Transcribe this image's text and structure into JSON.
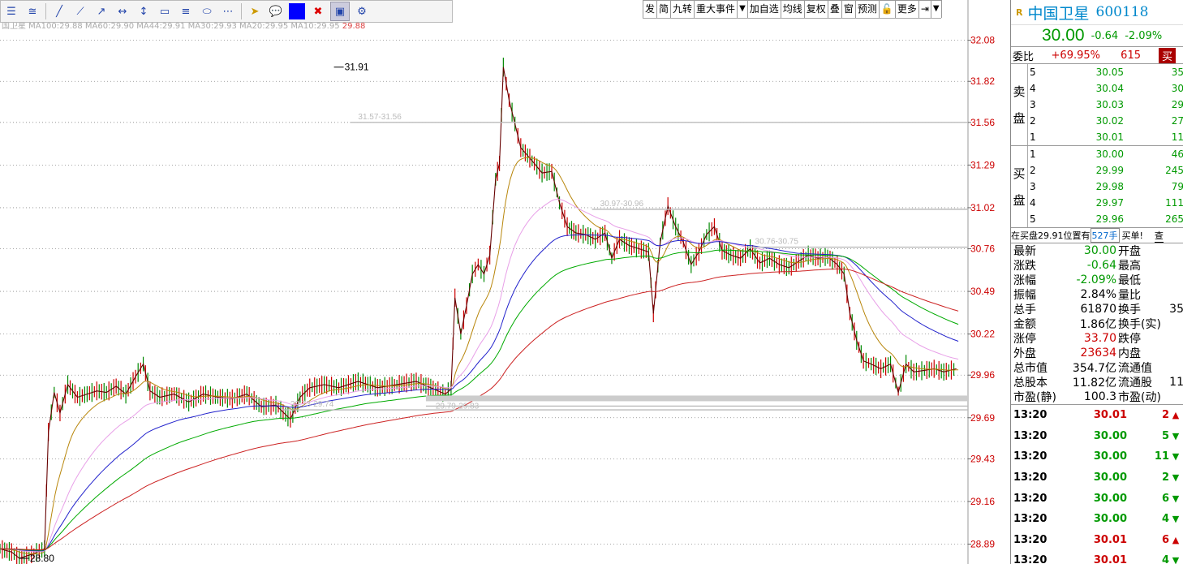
{
  "toolbar": {
    "tools": [
      "menu-icon",
      "ruler-icon",
      "line-icon",
      "segment-icon",
      "ray-icon",
      "hline-icon",
      "vline-icon",
      "rect-icon",
      "channel-icon",
      "ellipse-icon",
      "more-icon",
      "pointer-icon",
      "callout-icon",
      "color-swatch",
      "delete-icon",
      "hide-icon",
      "settings-icon"
    ]
  },
  "top_menu": [
    "发",
    "简",
    "九转",
    "重大事件",
    "",
    "加自选",
    "均线",
    "复权",
    "叠",
    "窗",
    "预测",
    "",
    "更多",
    ""
  ],
  "ma_legend": {
    "text": "国卫星  MA100:29.88  MA60:29.90  MA44:29.91  MA30:29.93  MA20:29.95  MA10:29.95",
    "highlight": "29.88"
  },
  "stock": {
    "badge": "R",
    "name": "中国卫星",
    "code": "600118",
    "price": "30.00",
    "change": "-0.64",
    "change_pct": "-2.09%",
    "ratio_label": "委比",
    "ratio_value": "+69.95%",
    "ratio_diff": "615",
    "ratio_btn": "买"
  },
  "orderbook": {
    "sell_label": [
      "卖",
      "盘"
    ],
    "buy_label": [
      "买",
      "盘"
    ],
    "sell": [
      {
        "level": "5",
        "price": "30.05",
        "vol": "35"
      },
      {
        "level": "4",
        "price": "30.04",
        "vol": "30"
      },
      {
        "level": "3",
        "price": "30.03",
        "vol": "29"
      },
      {
        "level": "2",
        "price": "30.02",
        "vol": "27"
      },
      {
        "level": "1",
        "price": "30.01",
        "vol": "11"
      }
    ],
    "buy": [
      {
        "level": "1",
        "price": "30.00",
        "vol": "46"
      },
      {
        "level": "2",
        "price": "29.99",
        "vol": "245"
      },
      {
        "level": "3",
        "price": "29.98",
        "vol": "79"
      },
      {
        "level": "4",
        "price": "29.97",
        "vol": "111"
      },
      {
        "level": "5",
        "price": "29.96",
        "vol": "265"
      }
    ]
  },
  "notice": {
    "text": "在买盘29.91位置有",
    "hl": "527手",
    "tail": "买单!",
    "btn": "查"
  },
  "stats": [
    {
      "l": "最新",
      "v": "30.00",
      "r": "开盘",
      "vc": "#090"
    },
    {
      "l": "涨跌",
      "v": "-0.64",
      "r": "最高",
      "vc": "#090"
    },
    {
      "l": "涨幅",
      "v": "-2.09%",
      "r": "最低",
      "vc": "#090"
    },
    {
      "l": "振幅",
      "v": "2.84%",
      "r": "量比",
      "vc": "#000"
    },
    {
      "l": "总手",
      "v": "61870",
      "r": "换手",
      "vc": "#000"
    },
    {
      "l": "金额",
      "v": "1.86亿",
      "r": "换手(实)",
      "vc": "#000"
    },
    {
      "l": "涨停",
      "v": "33.70",
      "r": "跌停",
      "vc": "#c00"
    },
    {
      "l": "外盘",
      "v": "23634",
      "r": "内盘",
      "vc": "#c00"
    },
    {
      "l": "总市值",
      "v": "354.7亿",
      "r": "流通值",
      "vc": "#000"
    },
    {
      "l": "总股本",
      "v": "11.82亿",
      "r": "流通股",
      "vc": "#000"
    },
    {
      "l": "市盈(静)",
      "v": "100.3",
      "r": "市盈(动)",
      "vc": "#000"
    }
  ],
  "stats_clip": [
    "",
    "",
    "",
    "",
    "35",
    "",
    "",
    "",
    "",
    "11",
    ""
  ],
  "ticks": [
    {
      "time": "13:20",
      "price": "30.01",
      "vol": "2",
      "dir": "up"
    },
    {
      "time": "13:20",
      "price": "30.00",
      "vol": "5",
      "dir": "down"
    },
    {
      "time": "13:20",
      "price": "30.00",
      "vol": "11",
      "dir": "down"
    },
    {
      "time": "13:20",
      "price": "30.00",
      "vol": "2",
      "dir": "down"
    },
    {
      "time": "13:20",
      "price": "30.00",
      "vol": "6",
      "dir": "down"
    },
    {
      "time": "13:20",
      "price": "30.00",
      "vol": "4",
      "dir": "down"
    },
    {
      "time": "13:20",
      "price": "30.01",
      "vol": "6",
      "dir": "up"
    },
    {
      "time": "13:20",
      "price": "30.01",
      "vol": "4",
      "dir": "down"
    }
  ],
  "colors": {
    "up": "#c00",
    "down": "#090",
    "price": "#000",
    "ma_fast": "#b8860b",
    "ma_mid": "#e8a0e8",
    "ma_slow": "#0a0",
    "ma_blue": "#22c",
    "ma_red": "#c22"
  },
  "chart_data": {
    "type": "line",
    "ylim": [
      28.8,
      32.15
    ],
    "y_ticks": [
      "32.08",
      "31.82",
      "31.56",
      "31.29",
      "31.02",
      "30.76",
      "30.49",
      "30.22",
      "29.96",
      "29.69",
      "29.43",
      "29.16",
      "28.89"
    ],
    "annotations": [
      {
        "text": "31.91",
        "x": 0.345,
        "y": 31.91
      },
      {
        "text": "28.80",
        "x": 0.02,
        "y": 28.8
      },
      {
        "text": "31.57-31.56",
        "x": 0.37,
        "y": 31.56,
        "type": "zone"
      },
      {
        "text": "30.97-30.96",
        "x": 0.62,
        "y": 31.01,
        "type": "zone"
      },
      {
        "text": "30.76-30.75",
        "x": 0.78,
        "y": 30.77,
        "type": "zone"
      },
      {
        "text": "29.79-29.83",
        "x": 0.45,
        "y": 29.81,
        "type": "band"
      },
      {
        "text": "29.73-29.74",
        "x": 0.3,
        "y": 29.74,
        "type": "zone"
      }
    ],
    "price_path": [
      [
        0.0,
        28.86
      ],
      [
        0.012,
        28.84
      ],
      [
        0.02,
        28.8
      ],
      [
        0.035,
        28.83
      ],
      [
        0.046,
        28.86
      ],
      [
        0.05,
        29.6
      ],
      [
        0.056,
        29.85
      ],
      [
        0.062,
        29.72
      ],
      [
        0.07,
        29.9
      ],
      [
        0.08,
        29.82
      ],
      [
        0.09,
        29.84
      ],
      [
        0.1,
        29.86
      ],
      [
        0.11,
        29.85
      ],
      [
        0.12,
        29.89
      ],
      [
        0.13,
        29.84
      ],
      [
        0.14,
        29.95
      ],
      [
        0.148,
        30.03
      ],
      [
        0.155,
        29.86
      ],
      [
        0.165,
        29.82
      ],
      [
        0.18,
        29.84
      ],
      [
        0.195,
        29.79
      ],
      [
        0.21,
        29.84
      ],
      [
        0.225,
        29.82
      ],
      [
        0.24,
        29.81
      ],
      [
        0.255,
        29.84
      ],
      [
        0.27,
        29.76
      ],
      [
        0.285,
        29.77
      ],
      [
        0.3,
        29.68
      ],
      [
        0.31,
        29.82
      ],
      [
        0.32,
        29.88
      ],
      [
        0.335,
        29.9
      ],
      [
        0.35,
        29.88
      ],
      [
        0.37,
        29.92
      ],
      [
        0.39,
        29.88
      ],
      [
        0.41,
        29.9
      ],
      [
        0.43,
        29.92
      ],
      [
        0.445,
        29.88
      ],
      [
        0.46,
        29.84
      ],
      [
        0.466,
        29.87
      ],
      [
        0.47,
        30.45
      ],
      [
        0.476,
        30.22
      ],
      [
        0.482,
        30.4
      ],
      [
        0.488,
        30.6
      ],
      [
        0.494,
        30.66
      ],
      [
        0.5,
        30.6
      ],
      [
        0.506,
        30.72
      ],
      [
        0.512,
        31.2
      ],
      [
        0.516,
        31.3
      ],
      [
        0.52,
        31.91
      ],
      [
        0.526,
        31.7
      ],
      [
        0.532,
        31.55
      ],
      [
        0.538,
        31.4
      ],
      [
        0.545,
        31.35
      ],
      [
        0.552,
        31.3
      ],
      [
        0.56,
        31.24
      ],
      [
        0.57,
        31.25
      ],
      [
        0.578,
        31.05
      ],
      [
        0.586,
        30.9
      ],
      [
        0.595,
        30.86
      ],
      [
        0.605,
        30.85
      ],
      [
        0.615,
        30.82
      ],
      [
        0.625,
        30.86
      ],
      [
        0.632,
        30.7
      ],
      [
        0.64,
        30.82
      ],
      [
        0.65,
        30.78
      ],
      [
        0.66,
        30.76
      ],
      [
        0.67,
        30.74
      ],
      [
        0.675,
        30.35
      ],
      [
        0.682,
        30.8
      ],
      [
        0.69,
        31.03
      ],
      [
        0.698,
        30.9
      ],
      [
        0.706,
        30.8
      ],
      [
        0.714,
        30.66
      ],
      [
        0.722,
        30.74
      ],
      [
        0.73,
        30.85
      ],
      [
        0.738,
        30.9
      ],
      [
        0.746,
        30.75
      ],
      [
        0.755,
        30.72
      ],
      [
        0.765,
        30.7
      ],
      [
        0.775,
        30.76
      ],
      [
        0.785,
        30.67
      ],
      [
        0.795,
        30.7
      ],
      [
        0.805,
        30.66
      ],
      [
        0.815,
        30.64
      ],
      [
        0.825,
        30.68
      ],
      [
        0.835,
        30.72
      ],
      [
        0.845,
        30.7
      ],
      [
        0.855,
        30.71
      ],
      [
        0.865,
        30.66
      ],
      [
        0.872,
        30.6
      ],
      [
        0.878,
        30.35
      ],
      [
        0.885,
        30.18
      ],
      [
        0.892,
        30.05
      ],
      [
        0.9,
        30.03
      ],
      [
        0.91,
        30.0
      ],
      [
        0.92,
        30.03
      ],
      [
        0.928,
        29.85
      ],
      [
        0.936,
        30.03
      ],
      [
        0.944,
        29.98
      ],
      [
        0.955,
        29.99
      ],
      [
        0.965,
        30.0
      ],
      [
        0.975,
        29.98
      ],
      [
        0.988,
        30.0
      ]
    ]
  }
}
